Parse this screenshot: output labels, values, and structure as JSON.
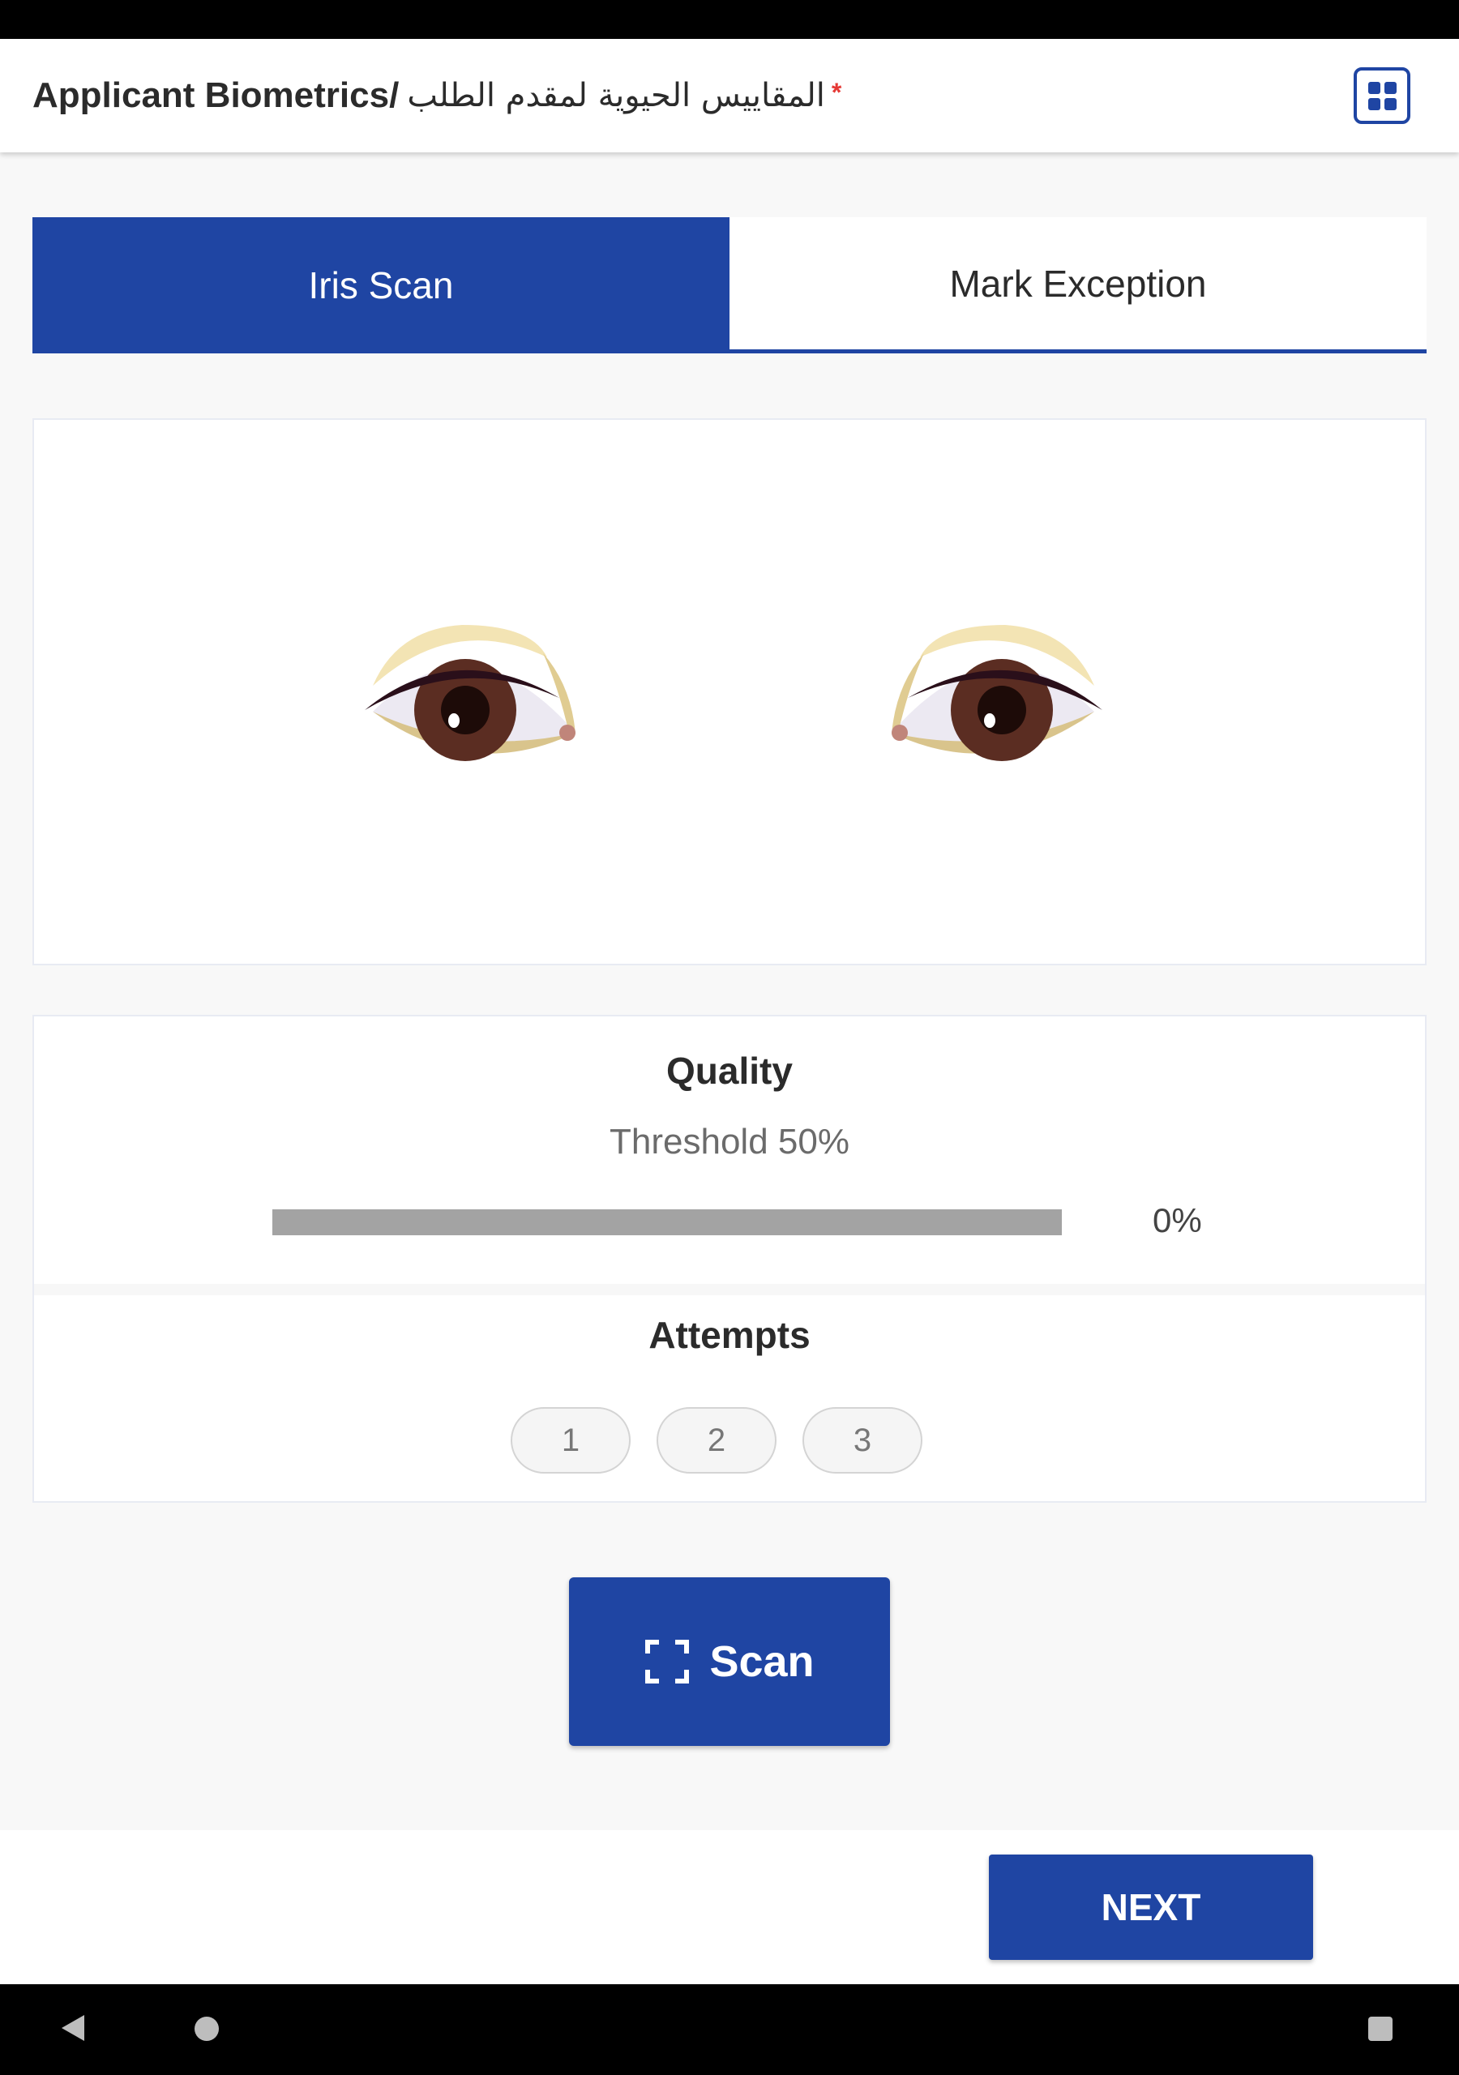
{
  "header": {
    "title": "Applicant Biometrics/",
    "title_arabic": "المقاييس الحيوية لمقدم الطلب",
    "required_marker": "*",
    "menu_icon": "grid-icon"
  },
  "tabs": [
    {
      "label": "Iris Scan",
      "active": true
    },
    {
      "label": "Mark Exception",
      "active": false
    }
  ],
  "eyes": {
    "left_icon": "eye-left-icon",
    "right_icon": "eye-right-icon"
  },
  "quality": {
    "title": "Quality",
    "threshold": "Threshold 50%",
    "progress_value": "0%",
    "progress_fraction": 0
  },
  "attempts": {
    "title": "Attempts",
    "items": [
      "1",
      "2",
      "3"
    ]
  },
  "scan_button": {
    "label": "Scan",
    "icon": "scan-frame-icon"
  },
  "footer": {
    "next_label": "NEXT"
  },
  "colors": {
    "primary": "#1f45a3",
    "required": "#e53935",
    "progress_track": "#a3a3a3"
  }
}
